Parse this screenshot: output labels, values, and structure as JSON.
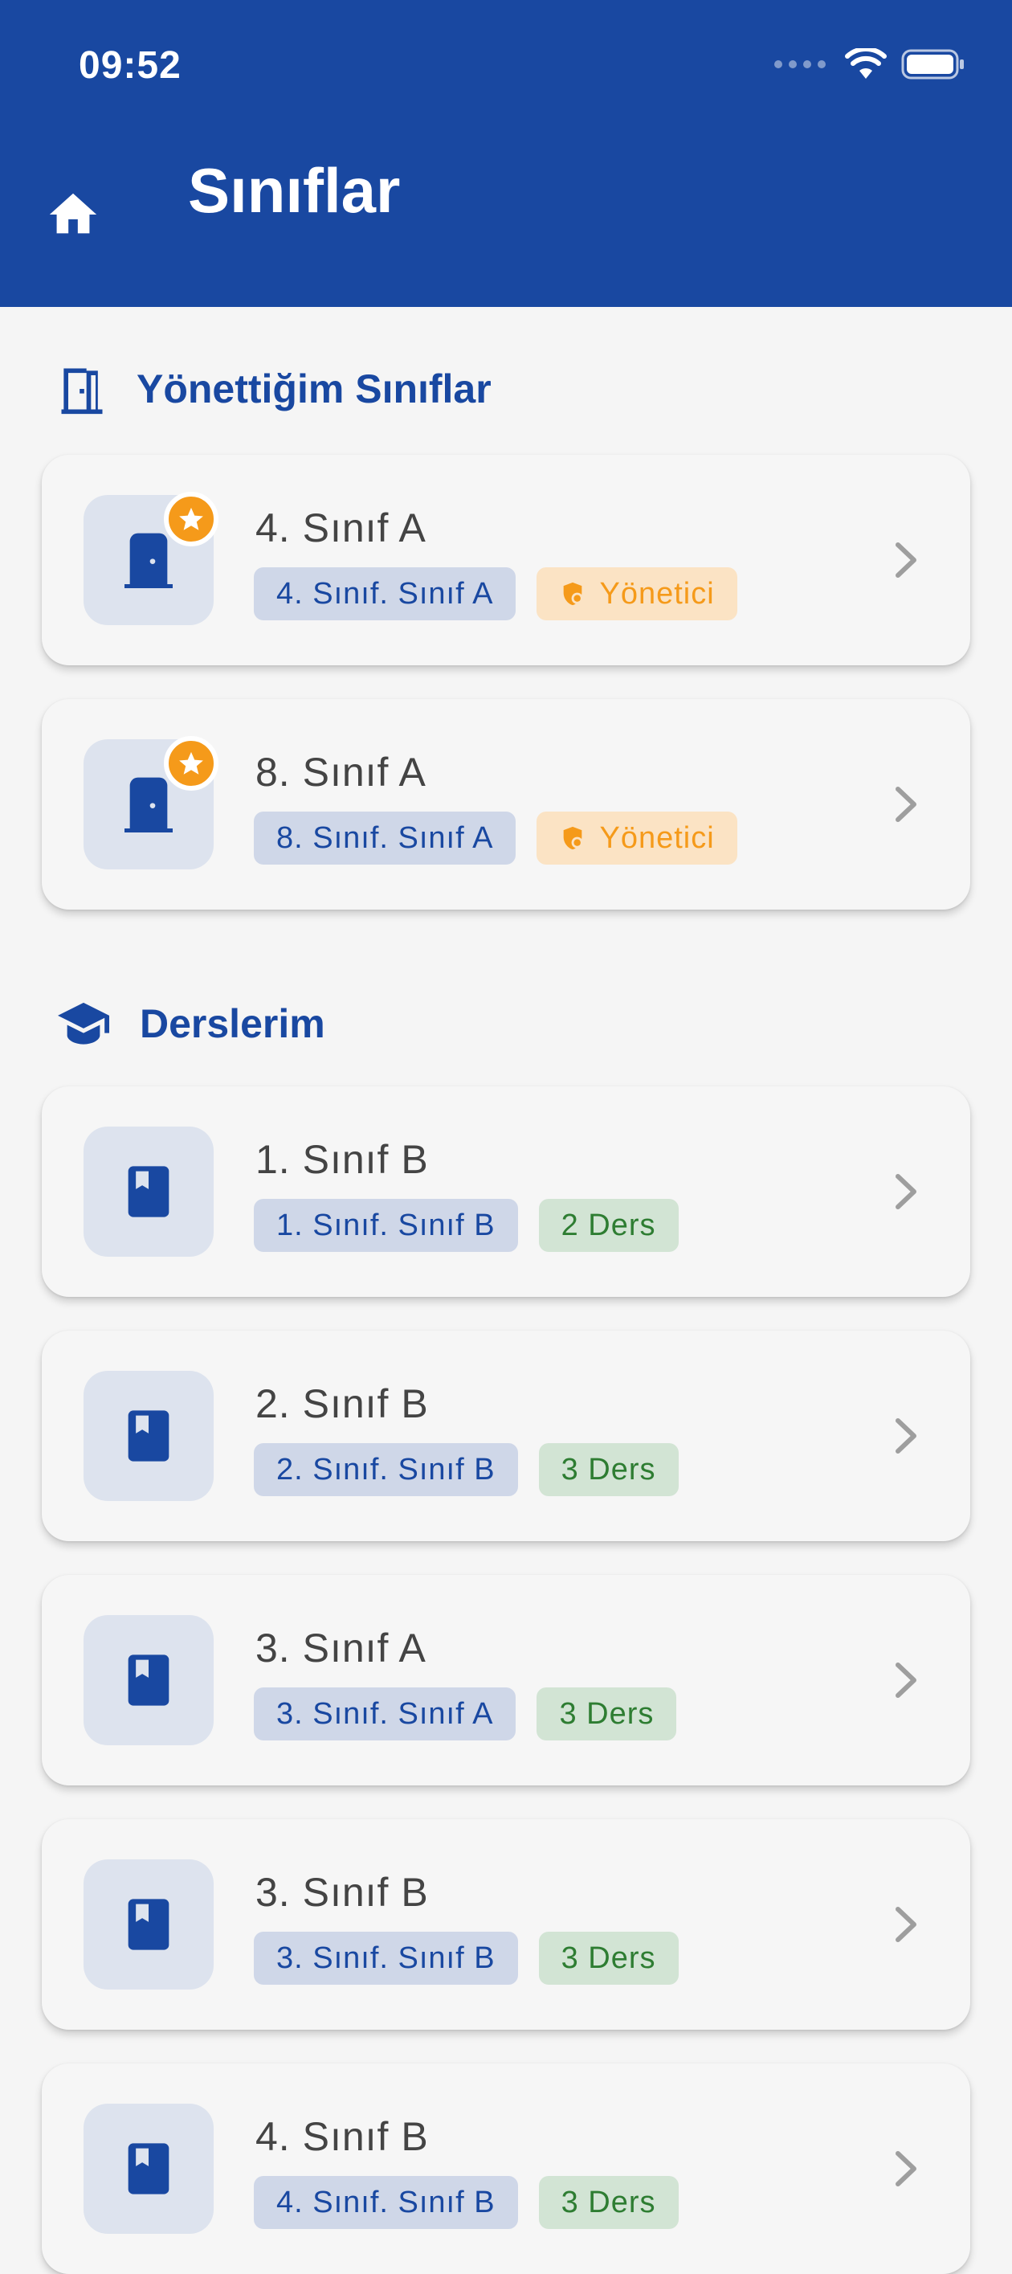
{
  "status_bar": {
    "time": "09:52"
  },
  "header": {
    "title": "Sınıflar",
    "home_icon": "home-icon",
    "color": "#1948a1"
  },
  "sections": {
    "managed": {
      "title": "Yönettiğim Sınıflar",
      "icon": "door-icon",
      "items": [
        {
          "title": "4. Sınıf A",
          "tag": "4. Sınıf. Sınıf A",
          "role": "Yönetici"
        },
        {
          "title": "8. Sınıf A",
          "tag": "8. Sınıf. Sınıf A",
          "role": "Yönetici"
        }
      ]
    },
    "lessons": {
      "title": "Derslerim",
      "icon": "graduation-cap-icon",
      "items": [
        {
          "title": "1. Sınıf B",
          "tag": "1. Sınıf. Sınıf B",
          "count": "2 Ders"
        },
        {
          "title": "2. Sınıf B",
          "tag": "2. Sınıf. Sınıf B",
          "count": "3 Ders"
        },
        {
          "title": "3. Sınıf A",
          "tag": "3. Sınıf. Sınıf A",
          "count": "3 Ders"
        },
        {
          "title": "3. Sınıf B",
          "tag": "3. Sınıf. Sınıf B",
          "count": "3 Ders"
        },
        {
          "title": "4. Sınıf B",
          "tag": "4. Sınıf. Sınıf B",
          "count": "3 Ders"
        }
      ]
    }
  },
  "colors": {
    "primary": "#1948a1",
    "admin_badge": "#f59a1a",
    "lesson_count": "#2e7d32"
  }
}
